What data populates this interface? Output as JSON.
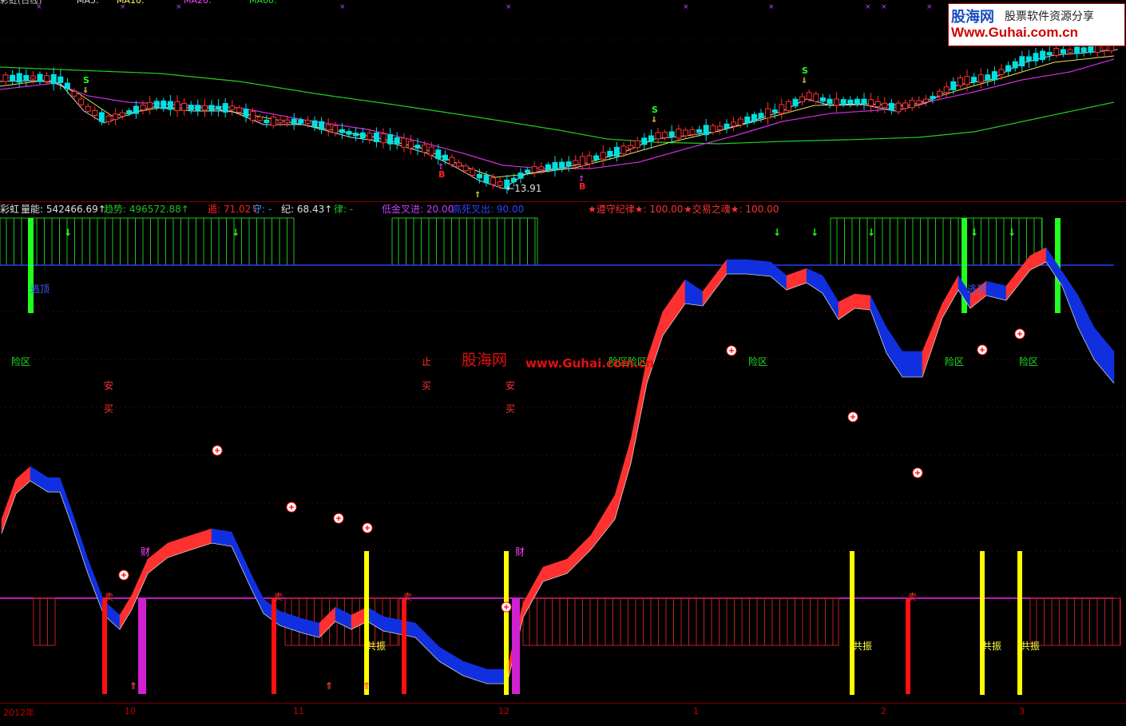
{
  "top_header": {
    "legend_fragments": [
      "彩虹(日线)",
      "MA5:",
      "MA10:",
      "MA20:",
      "MA60:"
    ]
  },
  "logo": {
    "name": "股海网",
    "tagline": "股票软件资源分享",
    "url": "Www.Guhai.com.cn"
  },
  "price_panel": {
    "low_price_label": "13.91",
    "signals": [
      {
        "type": "S",
        "label": "S"
      },
      {
        "type": "S",
        "label": "S"
      },
      {
        "type": "S",
        "label": "S"
      },
      {
        "type": "B",
        "label": "B"
      },
      {
        "type": "B",
        "label": "B"
      }
    ]
  },
  "indicator_header": {
    "name": "彩虹",
    "items": [
      {
        "label": "量能:",
        "value": "542466.69",
        "arrow": "↑",
        "color": "#e0e0e0"
      },
      {
        "label": "趋势:",
        "value": "496572.88",
        "arrow": "↑",
        "color": "#20c020"
      },
      {
        "label": "遁:",
        "value": "71.02",
        "arrow": "↓",
        "color": "#ff2020"
      },
      {
        "label": "守:",
        "value": "-",
        "arrow": "",
        "color": "#4090ff"
      },
      {
        "label": "纪:",
        "value": "68.43",
        "arrow": "↑",
        "color": "#e0e0e0"
      },
      {
        "label": "律:",
        "value": "-",
        "arrow": "",
        "color": "#20c020"
      },
      {
        "label": "低金叉进:",
        "value": "20.00",
        "arrow": "",
        "color": "#c040ff"
      },
      {
        "label": "高死叉出:",
        "value": "90.00",
        "arrow": "",
        "color": "#3040ff"
      },
      {
        "label": "★遵守纪律★:",
        "value": "100.00",
        "arrow": "",
        "color": "#ff3030"
      },
      {
        "label": "★交易之魂★:",
        "value": "100.00",
        "arrow": "",
        "color": "#ff3030"
      }
    ]
  },
  "indicator_labels": {
    "danger_zone": "险区",
    "safe": "安",
    "buy": "买",
    "stop": "止",
    "wealth": "财",
    "resonance": "共振",
    "sell": "卖",
    "leave": "逃顶"
  },
  "watermark": {
    "cn": "股海网",
    "url": "www.Guhai.com.cn"
  },
  "date_axis": {
    "year": "2012年",
    "months": [
      "10",
      "11",
      "12",
      "1",
      "2",
      "3"
    ]
  },
  "colors": {
    "background": "#000000",
    "up_candle": "#ff3030",
    "down_candle": "#00e0e0",
    "band_red": "#ff3030",
    "band_blue": "#1030e0",
    "green": "#20ff20",
    "yellow": "#ffff00",
    "magenta": "#ff20ff"
  }
}
